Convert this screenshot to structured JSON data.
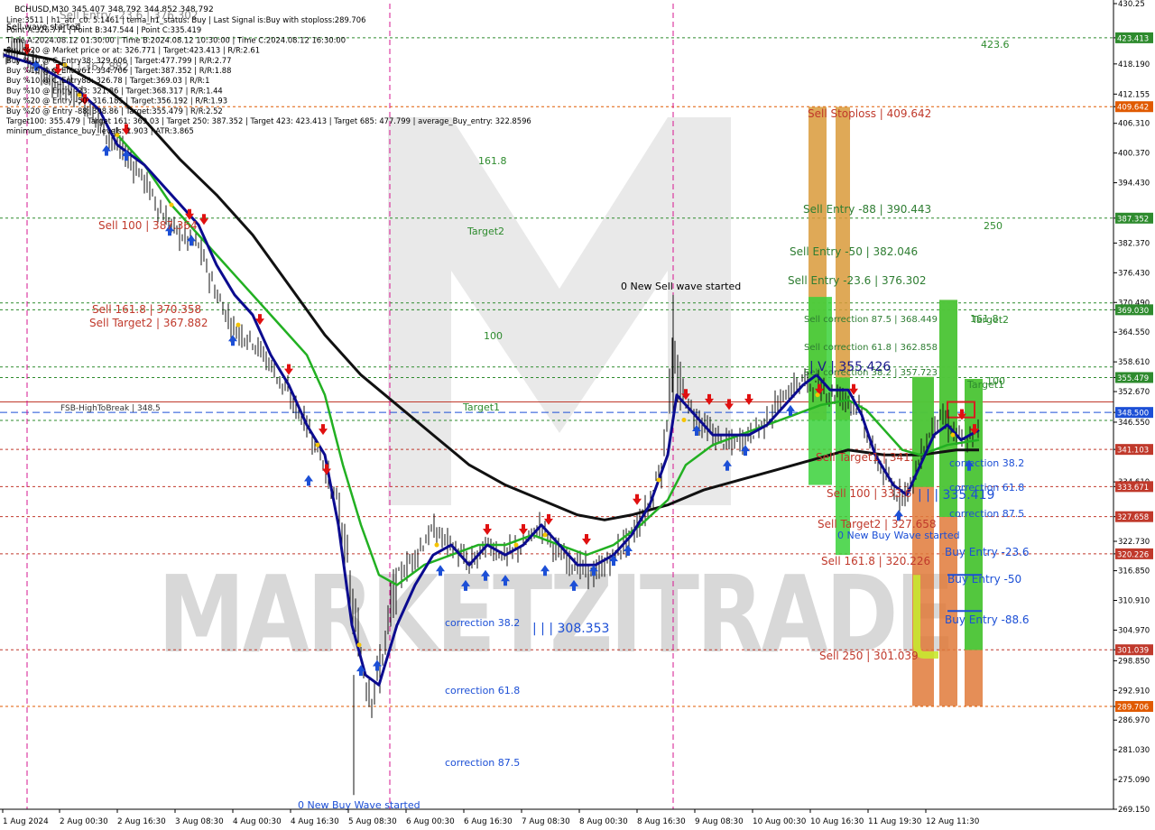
{
  "chart_data": {
    "type": "candlestick",
    "symbol_line": "BCHUSD,M30  345.407 348.792 344.852 348.792",
    "info_lines": [
      "Line:3511  |  h1_atr_c0: 5.1461  |  tema_h1_status: Buy  |  Last Signal is:Buy with stoploss:289.706",
      "Point A:326.771  |  Point B:347.544  |  Point C:335.419",
      "Time A:2024.08.12 01:30:00  |  Time B:2024.08.12 10:30:00  |  Time C:2024.08.12 16:30:00",
      "Buy %20 @ Market price or at: 326.771  |  Target:423.413  |  R/R:2.61",
      "Buy %10 @ C_Entry38: 329.606  |  Target:477.799  |  R/R:2.77",
      "Buy %10 @ C_Entry61: 334.706  |  Target:387.352  |  R/R:1.88",
      "Buy %10 @ C_Entry88: 326.78  |  Target:369.03  |  R/R:1",
      "Buy %10 @ Entry -23: 321.86  |  Target:368.317  |  R/R:1.44",
      "Buy %20 @ Entry -50: 316.185  |  Target:356.192  |  R/R:1.93",
      "Buy %20 @ Entry -88: 308.86  |  Target:355.479  |  R/R:2.52",
      "Target100: 355.479  |  Target 161: 369.03  |  Target 250: 387.352  |  Target 423: 423.413  |  Target 685: 477.799  |  average_Buy_entry: 322.8596",
      "minimum_distance_buy_levels: 1.903  |  ATR:3.865"
    ],
    "overlay_top": [
      "Sell Entry -23.6 | 376.302",
      "Sell wave started",
      "| | | 367.882"
    ],
    "y_axis": {
      "min": 269.15,
      "max": 430.25,
      "ticks": [
        "430.25",
        "423.413",
        "418.190",
        "412.155",
        "409.642",
        "406.310",
        "400.370",
        "394.430",
        "387.352",
        "382.370",
        "376.430",
        "370.490",
        "369.030",
        "364.550",
        "358.610",
        "355.479",
        "352.670",
        "348.500",
        "346.550",
        "341.103",
        "334.610",
        "333.671",
        "327.658",
        "322.730",
        "320.226",
        "316.850",
        "310.910",
        "304.970",
        "301.039",
        "298.850",
        "292.910",
        "289.706",
        "286.970",
        "281.030",
        "275.090",
        "269.150"
      ]
    },
    "x_axis": {
      "ticks": [
        "1 Aug 2024",
        "2 Aug 00:30",
        "2 Aug 16:30",
        "3 Aug 08:30",
        "4 Aug 00:30",
        "4 Aug 16:30",
        "5 Aug 08:30",
        "6 Aug 00:30",
        "6 Aug 16:30",
        "7 Aug 08:30",
        "8 Aug 00:30",
        "8 Aug 16:30",
        "9 Aug 08:30",
        "10 Aug 00:30",
        "10 Aug 16:30",
        "11 Aug 19:30",
        "12 Aug 11:30"
      ]
    },
    "highlight_prices": [
      {
        "value": 423.413,
        "label": "423.413",
        "color": "#2e8b2e"
      },
      {
        "value": 409.642,
        "label": "409.642",
        "color": "#e05a00"
      },
      {
        "value": 387.352,
        "label": "387.352",
        "color": "#2e8b2e"
      },
      {
        "value": 369.03,
        "label": "369.030",
        "color": "#2e8b2e"
      },
      {
        "value": 355.479,
        "label": "355.479",
        "color": "#2e8b2e"
      },
      {
        "value": 348.5,
        "label": "348.500",
        "color": "#1c4fd6"
      },
      {
        "value": 341.103,
        "label": "341.103",
        "color": "#c0392b"
      },
      {
        "value": 333.671,
        "label": "333.671",
        "color": "#c0392b"
      },
      {
        "value": 327.658,
        "label": "327.658",
        "color": "#c0392b"
      },
      {
        "value": 320.226,
        "label": "320.226",
        "color": "#c0392b"
      },
      {
        "value": 301.039,
        "label": "301.039",
        "color": "#c0392b"
      },
      {
        "value": 289.706,
        "label": "289.706",
        "color": "#e05a00"
      }
    ],
    "level_labels": [
      {
        "text": "423.6",
        "color": "#2e8b2e"
      },
      {
        "text": "161.8",
        "color": "#2e8b2e"
      },
      {
        "text": "Target2",
        "color": "#2e8b2e"
      },
      {
        "text": "250",
        "color": "#2e8b2e"
      },
      {
        "text": "100",
        "color": "#2e8b2e"
      },
      {
        "text": "Target1",
        "color": "#2e8b2e"
      },
      {
        "text": "161.8",
        "color": "#2e8b2e"
      },
      {
        "text": "Target2",
        "color": "#2e8b2e"
      },
      {
        "text": "100",
        "color": "#2e8b2e"
      },
      {
        "text": "Target1",
        "color": "#2e8b2e"
      },
      {
        "text": "Sell 100 | 387.364",
        "color": "#c0392b"
      },
      {
        "text": "Sell 161.8 | 370.358",
        "color": "#c0392b"
      },
      {
        "text": "Sell Target2 | 367.882",
        "color": "#c0392b"
      },
      {
        "text": "FSB-HighToBreak | 348.5",
        "color": "#333333"
      },
      {
        "text": "Sell Stoploss | 409.642",
        "color": "#c0392b"
      },
      {
        "text": "Sell Entry -88 | 390.443",
        "color": "#2e7d32"
      },
      {
        "text": "Sell Entry -50 | 382.046",
        "color": "#2e7d32"
      },
      {
        "text": "Sell Entry -23.6 | 376.302",
        "color": "#2e7d32"
      },
      {
        "text": "Sell correction 87.5 | 368.449",
        "color": "#2e7d32"
      },
      {
        "text": "Sell correction 61.8 | 362.858",
        "color": "#2e7d32"
      },
      {
        "text": "Sell correction 38.2 | 357.723",
        "color": "#2e7d32"
      },
      {
        "text": "| V | 355.426",
        "color": "#1a1a8c"
      },
      {
        "text": "Sell Target1 | 341.",
        "color": "#c0392b"
      },
      {
        "text": "Sell 100 | 333.6",
        "color": "#c0392b"
      },
      {
        "text": "| | | 335.419",
        "color": "#1c4fd6"
      },
      {
        "text": "Sell Target2 | 327.658",
        "color": "#c0392b"
      },
      {
        "text": "0 New Buy Wave started",
        "color": "#1c4fd6"
      },
      {
        "text": "Sell 161.8 | 320.226",
        "color": "#c0392b"
      },
      {
        "text": "Sell  250 | 301.039",
        "color": "#c0392b"
      },
      {
        "text": "correction 38.2",
        "color": "#1c4fd6"
      },
      {
        "text": "correction 61.8",
        "color": "#1c4fd6"
      },
      {
        "text": "correction 87.5",
        "color": "#1c4fd6"
      },
      {
        "text": "Buy Entry -23.6",
        "color": "#1c4fd6"
      },
      {
        "text": "Buy Entry -50",
        "color": "#1c4fd6"
      },
      {
        "text": "Buy Entry -88.6",
        "color": "#1c4fd6"
      },
      {
        "text": "0 New Sell wave started",
        "color": "#000000"
      },
      {
        "text": "| | | 308.353",
        "color": "#1c4fd6"
      },
      {
        "text": "correction 38.2",
        "color": "#1c4fd6"
      },
      {
        "text": "correction 61.8",
        "color": "#1c4fd6"
      },
      {
        "text": "correction 87.5",
        "color": "#1c4fd6"
      },
      {
        "text": "0 New Buy Wave started",
        "color": "#1c4fd6"
      }
    ],
    "watermark": "MARKETZITRADE",
    "colors": {
      "ema_black": "#111111",
      "ema_green": "#22b022",
      "ema_blue": "#0b0b8f",
      "sell_bar": "#d99a3a",
      "buy_bar": "#3ad13a",
      "dl_bar": "#e07a3a",
      "vline": "#d6148f",
      "grid_green": "#2e8b2e",
      "grid_red": "#c0392b"
    }
  }
}
